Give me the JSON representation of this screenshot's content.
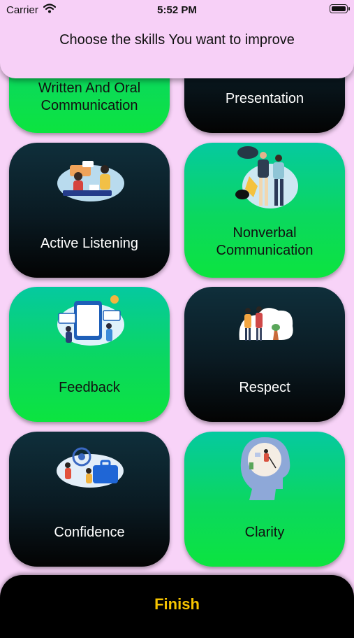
{
  "status_bar": {
    "carrier": "Carrier",
    "time": "5:52 PM"
  },
  "header": {
    "title": "Choose the skills You want to improve"
  },
  "skills": [
    {
      "label_lines": [
        "Written And Oral",
        "Communication"
      ],
      "style": "green",
      "icon": "communication-illustration"
    },
    {
      "label_lines": [
        "Presentation"
      ],
      "style": "dark",
      "icon": "presentation-illustration"
    },
    {
      "label_lines": [
        "Active Listening"
      ],
      "style": "dark",
      "icon": "listening-illustration"
    },
    {
      "label_lines": [
        "Nonverbal",
        "Communication"
      ],
      "style": "green",
      "icon": "nonverbal-illustration"
    },
    {
      "label_lines": [
        "Feedback"
      ],
      "style": "green",
      "icon": "feedback-illustration"
    },
    {
      "label_lines": [
        "Respect"
      ],
      "style": "dark",
      "icon": "respect-illustration"
    },
    {
      "label_lines": [
        "Confidence"
      ],
      "style": "dark",
      "icon": "confidence-illustration"
    },
    {
      "label_lines": [
        "Clarity"
      ],
      "style": "green",
      "icon": "clarity-illustration"
    }
  ],
  "footer": {
    "finish_label": "Finish"
  },
  "colors": {
    "background": "#f8d3f8",
    "green_accent": "#0bd85e",
    "dark_card": "#0a1a22",
    "finish_text": "#f6c400"
  }
}
